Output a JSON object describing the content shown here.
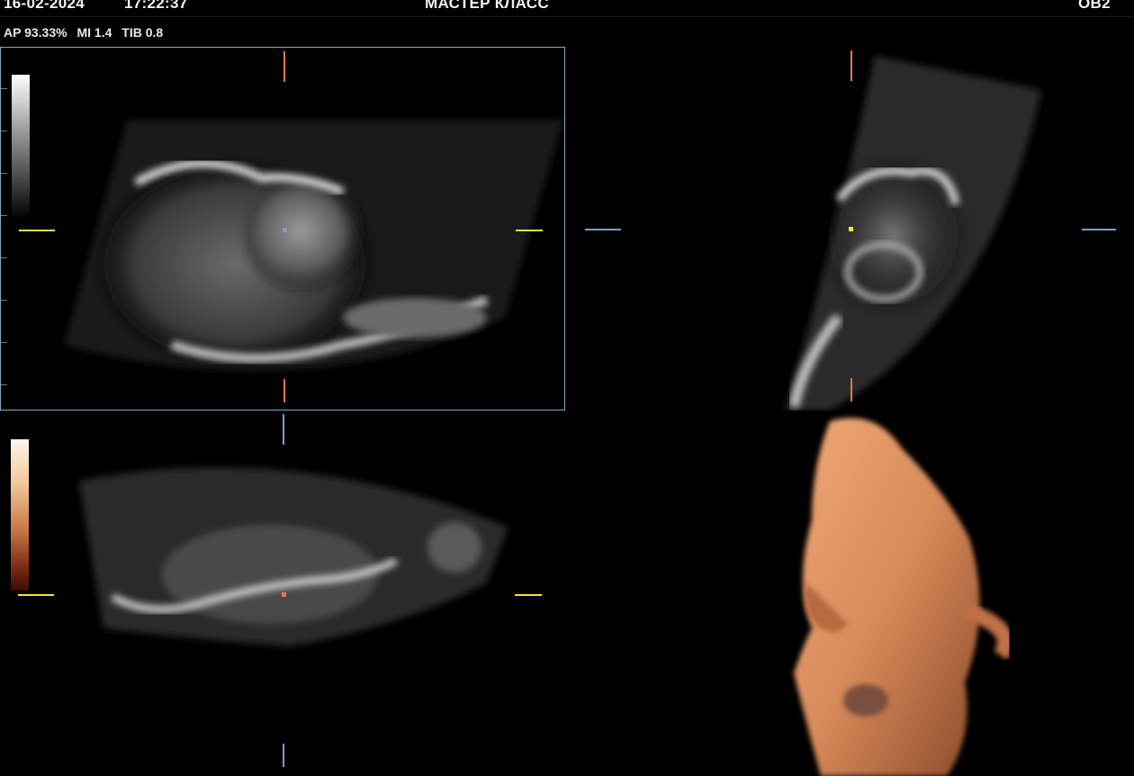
{
  "header": {
    "date": "16-02-2024",
    "time": "17:22:37",
    "title": "МАСТЕР КЛАСС",
    "preset": "OB2"
  },
  "params": {
    "ap": "AP 93.33%",
    "mi": "MI 1.4",
    "tib": "TIB 0.8"
  },
  "colors": {
    "active_border": "#8aa7c4",
    "axis_orange": "#e07a4a",
    "axis_yellow": "#f5e13a",
    "axis_blue": "#7d9ec4",
    "render_tone": "#c8794a"
  },
  "panes": [
    {
      "id": "A",
      "type": "grayscale sagittal plane",
      "active": true
    },
    {
      "id": "B",
      "type": "grayscale transverse plane",
      "active": false
    },
    {
      "id": "C",
      "type": "grayscale coronal plane",
      "active": false
    },
    {
      "id": "D",
      "type": "3D surface render",
      "active": false
    }
  ]
}
